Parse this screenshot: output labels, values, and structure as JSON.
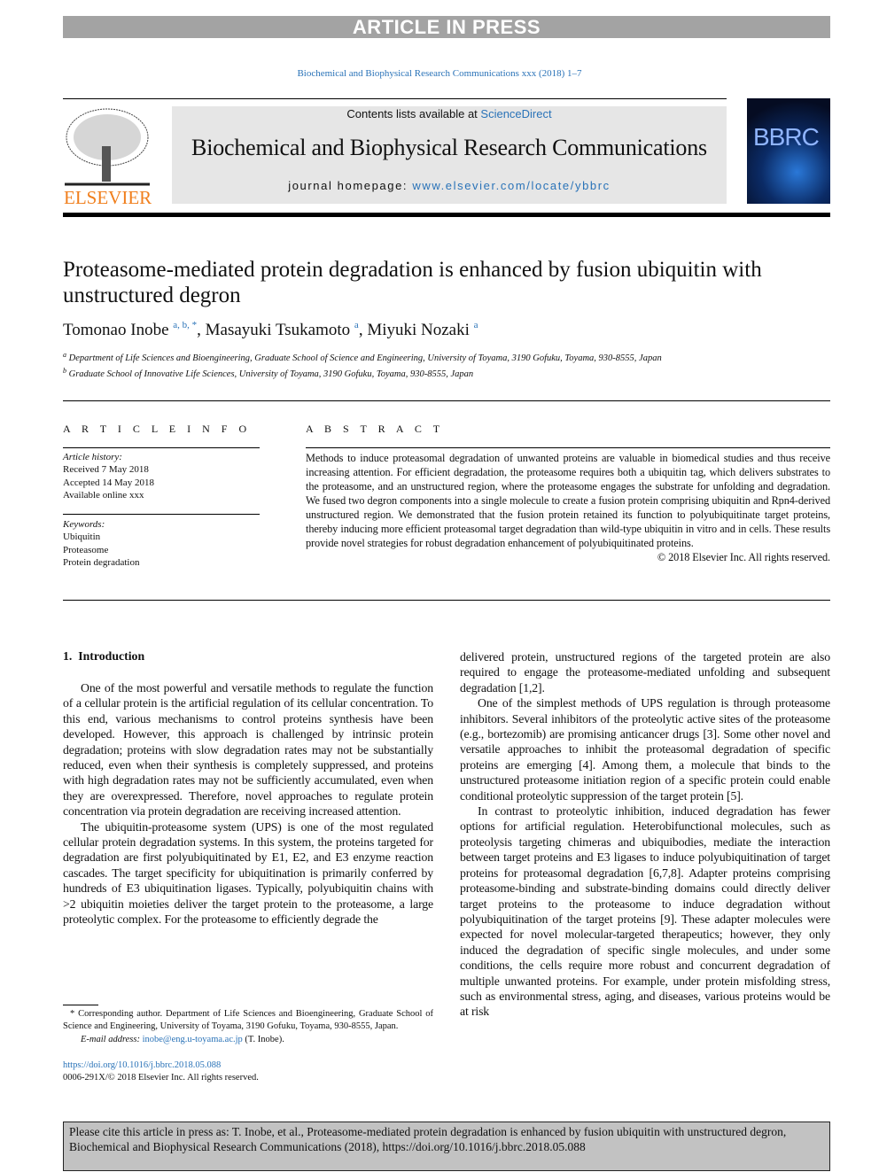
{
  "banner": "ARTICLE IN PRESS",
  "journal_ref": "Biochemical and Biophysical Research Communications xxx (2018) 1–7",
  "header": {
    "contents_prefix": "Contents lists available at ",
    "sciencedirect": "ScienceDirect",
    "journal_title": "Biochemical and Biophysical Research Communications",
    "homepage_prefix": "journal homepage: ",
    "homepage_url": "www.elsevier.com/locate/ybbrc",
    "publisher_logo": "ELSEVIER",
    "cover_logo": "BBRC"
  },
  "article": {
    "title": "Proteasome-mediated protein degradation is enhanced by fusion ubiquitin with unstructured degron",
    "authors": [
      {
        "name": "Tomonao Inobe",
        "marks": "a, b, *"
      },
      {
        "name": "Masayuki Tsukamoto",
        "marks": "a"
      },
      {
        "name": "Miyuki Nozaki",
        "marks": "a"
      }
    ],
    "affiliations": [
      {
        "mark": "a",
        "text": "Department of Life Sciences and Bioengineering, Graduate School of Science and Engineering, University of Toyama, 3190 Gofuku, Toyama, 930-8555, Japan"
      },
      {
        "mark": "b",
        "text": "Graduate School of Innovative Life Sciences, University of Toyama, 3190 Gofuku, Toyama, 930-8555, Japan"
      }
    ]
  },
  "article_info": {
    "heading": "A R T I C L E   I N F O",
    "history_label": "Article history:",
    "history": [
      "Received 7 May 2018",
      "Accepted 14 May 2018",
      "Available online xxx"
    ],
    "keywords_label": "Keywords:",
    "keywords": [
      "Ubiquitin",
      "Proteasome",
      "Protein degradation"
    ]
  },
  "abstract": {
    "heading": "A B S T R A C T",
    "text": "Methods to induce proteasomal degradation of unwanted proteins are valuable in biomedical studies and thus receive increasing attention. For efficient degradation, the proteasome requires both a ubiquitin tag, which delivers substrates to the proteasome, and an unstructured region, where the proteasome engages the substrate for unfolding and degradation. We fused two degron components into a single molecule to create a fusion protein comprising ubiquitin and Rpn4-derived unstructured region. We demonstrated that the fusion protein retained its function to polyubiquitinate target proteins, thereby inducing more efficient proteasomal target degradation than wild-type ubiquitin in vitro and in cells. These results provide novel strategies for robust degradation enhancement of polyubiquitinated proteins.",
    "copyright": "© 2018 Elsevier Inc. All rights reserved."
  },
  "intro": {
    "heading": "1.  Introduction",
    "left_paragraphs": [
      "One of the most powerful and versatile methods to regulate the function of a cellular protein is the artificial regulation of its cellular concentration. To this end, various mechanisms to control proteins synthesis have been developed. However, this approach is challenged by intrinsic protein degradation; proteins with slow degradation rates may not be substantially reduced, even when their synthesis is completely suppressed, and proteins with high degradation rates may not be sufficiently accumulated, even when they are overexpressed. Therefore, novel approaches to regulate protein concentration via protein degradation are receiving increased attention.",
      "The ubiquitin-proteasome system (UPS) is one of the most regulated cellular protein degradation systems. In this system, the proteins targeted for degradation are first polyubiquitinated by E1, E2, and E3 enzyme reaction cascades. The target specificity for ubiquitination is primarily conferred by hundreds of E3 ubiquitination ligases. Typically, polyubiquitin chains with >2 ubiquitin moieties deliver the target protein to the proteasome, a large proteolytic complex. For the proteasome to efficiently degrade the"
    ],
    "right_paragraphs": [
      "delivered protein, unstructured regions of the targeted protein are also required to engage the proteasome-mediated unfolding and subsequent degradation [1,2].",
      "One of the simplest methods of UPS regulation is through proteasome inhibitors. Several inhibitors of the proteolytic active sites of the proteasome (e.g., bortezomib) are promising anticancer drugs [3]. Some other novel and versatile approaches to inhibit the proteasomal degradation of specific proteins are emerging [4]. Among them, a molecule that binds to the unstructured proteasome initiation region of a specific protein could enable conditional proteolytic suppression of the target protein [5].",
      "In contrast to proteolytic inhibition, induced degradation has fewer options for artificial regulation. Heterobifunctional molecules, such as proteolysis targeting chimeras and ubiquibodies, mediate the interaction between target proteins and E3 ligases to induce polyubiquitination of target proteins for proteasomal degradation [6,7,8]. Adapter proteins comprising proteasome-binding and substrate-binding domains could directly deliver target proteins to the proteasome to induce degradation without polyubiquitination of the target proteins [9]. These adapter molecules were expected for novel molecular-targeted therapeutics; however, they only induced the degradation of specific single molecules, and under some conditions, the cells require more robust and concurrent degradation of multiple unwanted proteins. For example, under protein misfolding stress, such as environmental stress, aging, and diseases, various proteins would be at risk"
    ]
  },
  "footnote": {
    "text": "* Corresponding author. Department of Life Sciences and Bioengineering, Graduate School of Science and Engineering, University of Toyama, 3190 Gofuku, Toyama, 930-8555, Japan.",
    "email_label": "E-mail address: ",
    "email": "inobe@eng.u-toyama.ac.jp",
    "email_suffix": " (T. Inobe).",
    "doi": "https://doi.org/10.1016/j.bbrc.2018.05.088",
    "issn": "0006-291X/© 2018 Elsevier Inc. All rights reserved."
  },
  "cite_box": "Please cite this article in press as: T. Inobe, et al., Proteasome-mediated protein degradation is enhanced by fusion ubiquitin with unstructured degron, Biochemical and Biophysical Research Communications (2018), https://doi.org/10.1016/j.bbrc.2018.05.088"
}
